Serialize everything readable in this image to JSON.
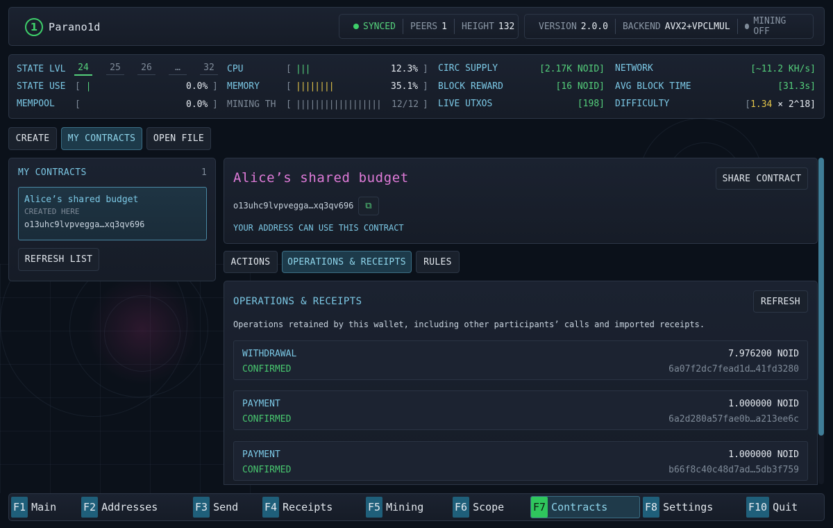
{
  "app": {
    "logo_glyph": "1",
    "name": "Parano1d"
  },
  "status": {
    "sync_label": "SYNCED",
    "peers_label": "PEERS",
    "peers_value": "1",
    "height_label": "HEIGHT",
    "height_value": "132",
    "version_label": "VERSION",
    "version_value": "2.0.0",
    "backend_label": "BACKEND",
    "backend_value": "AVX2+VPCLMUL",
    "mining_label": "MINING OFF"
  },
  "stats": {
    "state_lvl_label": "STATE LVL",
    "levels": [
      "24",
      "25",
      "26",
      "…",
      "32"
    ],
    "active_level": "24",
    "state_use_label": "STATE USE",
    "state_use_value": "0.0%",
    "mempool_label": "MEMPOOL",
    "mempool_value": "0.0%",
    "cpu_label": "CPU",
    "cpu_bars": "|||",
    "cpu_value": "12.3%",
    "memory_label": "MEMORY",
    "memory_bars": "||||||||",
    "memory_value": "35.1%",
    "mining_th_label": "MINING TH",
    "mining_th_bars": "||||||||||||||||||",
    "mining_th_value": "12/12",
    "circ_supply_label": "CIRC SUPPLY",
    "circ_supply_value": "[2.17K NOID]",
    "block_reward_label": "BLOCK REWARD",
    "block_reward_value": "[16 NOID]",
    "live_utxos_label": "LIVE UTXOS",
    "live_utxos_value": "[198]",
    "network_label": "NETWORK",
    "network_value": "[~11.2 KH/s]",
    "avg_block_time_label": "AVG BLOCK TIME",
    "avg_block_time_value": "[31.3s]",
    "difficulty_label": "DIFFICULTY",
    "difficulty_open": "[",
    "difficulty_value": "1.34",
    "difficulty_rest": " × 2^18]"
  },
  "top_tabs": [
    {
      "label": "CREATE"
    },
    {
      "label": "MY CONTRACTS"
    },
    {
      "label": "OPEN FILE"
    }
  ],
  "sidebar": {
    "title": "MY CONTRACTS",
    "count": "1",
    "contract": {
      "name": "Alice’s shared budget",
      "origin": "CREATED HERE",
      "address": "o13uhc9lvpvegga…xq3qv696"
    },
    "refresh_label": "REFRESH LIST"
  },
  "detail": {
    "title": "Alice’s shared budget",
    "share_label": "SHARE CONTRACT",
    "address": "o13uhc9lvpvegga…xq3qv696",
    "copy_glyph": "⧉",
    "permission_note": "YOUR ADDRESS CAN USE THIS CONTRACT",
    "tabs": [
      {
        "label": "ACTIONS"
      },
      {
        "label": "OPERATIONS & RECEIPTS"
      },
      {
        "label": "RULES"
      }
    ]
  },
  "operations": {
    "title": "OPERATIONS & RECEIPTS",
    "refresh_label": "REFRESH",
    "description": "Operations retained by this wallet, including other participants’ calls and imported receipts.",
    "items": [
      {
        "type": "WITHDRAWAL",
        "status": "CONFIRMED",
        "amount": "7.976200 NOID",
        "hash": "6a07f2dc7fead1d…41fd3280"
      },
      {
        "type": "PAYMENT",
        "status": "CONFIRMED",
        "amount": "1.000000 NOID",
        "hash": "6a2d280a57fae0b…a213ee6c"
      },
      {
        "type": "PAYMENT",
        "status": "CONFIRMED",
        "amount": "1.000000 NOID",
        "hash": "b66f8c40c48d7ad…5db3f759"
      }
    ]
  },
  "footer": [
    {
      "key": "F1",
      "label": "Main"
    },
    {
      "key": "F2",
      "label": "Addresses"
    },
    {
      "key": "F3",
      "label": "Send"
    },
    {
      "key": "F4",
      "label": "Receipts"
    },
    {
      "key": "F5",
      "label": "Mining"
    },
    {
      "key": "F6",
      "label": "Scope"
    },
    {
      "key": "F7",
      "label": "Contracts"
    },
    {
      "key": "F8",
      "label": "Settings"
    },
    {
      "key": "F10",
      "label": "Quit"
    }
  ],
  "colors": {
    "accent_cyan": "#7cc9e6",
    "status_green": "#55d17c",
    "title_pink": "#e07bd9",
    "difficulty_yellow": "#e4c64a",
    "active_tab": "#1d3a4a"
  }
}
